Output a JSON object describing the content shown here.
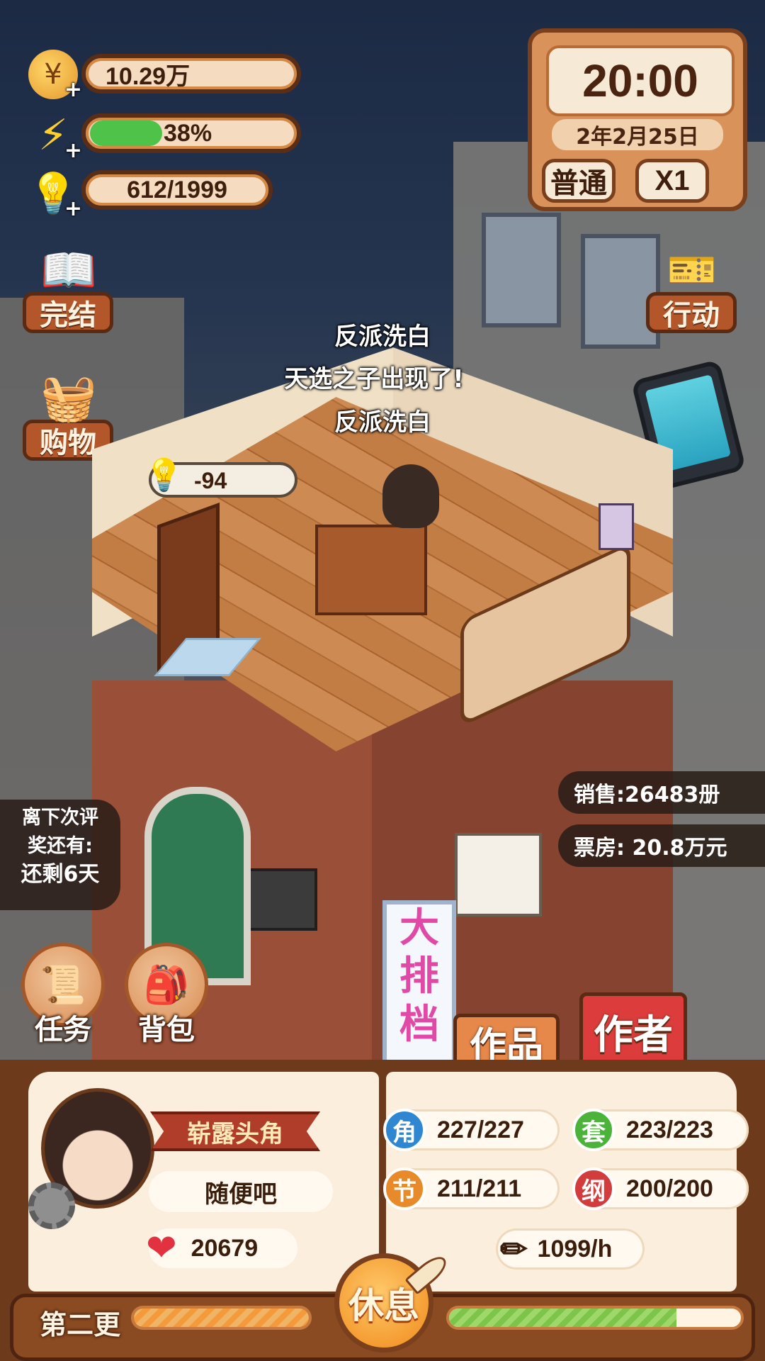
{
  "resources": {
    "coins": "10.29万",
    "energy": {
      "label": "38%",
      "percent": 38
    },
    "ideas": "612/1999"
  },
  "clock": {
    "time": "20:00",
    "date": "2年2月25日",
    "mode": "普通",
    "speed": "X1"
  },
  "left_menu": {
    "finish": "完结",
    "shop": "购物"
  },
  "right_menu": {
    "action": "行动"
  },
  "floating_texts": [
    "反派洗白",
    "天选之子出现了!",
    "反派洗白"
  ],
  "idea_bubble": "-94",
  "sales": {
    "books": "销售:26483册",
    "box_office": "票房: 20.8万元"
  },
  "review_timer": {
    "line1": "离下次评",
    "line2": "奖还有:",
    "remaining": "还剩6天"
  },
  "round_buttons": {
    "tasks": "任务",
    "bag": "背包"
  },
  "tabs": {
    "works": "作品",
    "author": "作者"
  },
  "profile": {
    "title": "崭露头角",
    "name": "随便吧",
    "likes": "20679"
  },
  "stats": {
    "role": {
      "badge": "角",
      "value": "227/227"
    },
    "set": {
      "badge": "套",
      "value": "223/223"
    },
    "chapter": {
      "badge": "节",
      "value": "211/211"
    },
    "outline": {
      "badge": "纲",
      "value": "200/200"
    },
    "rate": "1099/h"
  },
  "bottom": {
    "update_label": "第二更",
    "rest_button": "休息",
    "update_progress": 100,
    "writing_progress": 78
  },
  "colors": {
    "role": "#2f86d1",
    "set": "#4cb33a",
    "chapter": "#e88a2a",
    "outline": "#d23c3c",
    "energy": "#4fc24a"
  }
}
